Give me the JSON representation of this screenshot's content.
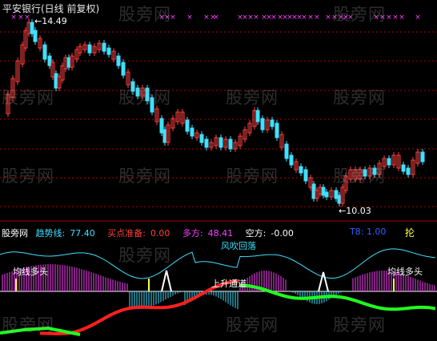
{
  "header": {
    "title": "平安银行(日线 前复权)",
    "high_label": "←14.49",
    "low_label": "←10.03"
  },
  "indicator": {
    "name": "股旁网",
    "trend_label": "趋势线:",
    "trend_value": "77.40",
    "buy_label": "买点准备:",
    "buy_value": "0.00",
    "long_label": "多方:",
    "long_value": "48.41",
    "short_label": "空方:",
    "short_value": "-0.00",
    "t8_label": "T8:",
    "t8_value": "1.00",
    "corner_glyph": "抡"
  },
  "annotations": {
    "blow": "风吹回落",
    "bull_left": "均线多头",
    "uptrend": "上升通道",
    "bull_right": "均线多头"
  },
  "watermark": "股旁网",
  "colors": {
    "up_candle": "#ff4040",
    "down_candle": "#40e0ff",
    "grid": "#b00000",
    "trend_line": "#40e0ff",
    "long_bar": "#ff40ff",
    "short_bar": "#40e0ff",
    "red_line": "#ff2020",
    "green_line": "#20ff20",
    "x_marker": "#ff40ff"
  }
}
